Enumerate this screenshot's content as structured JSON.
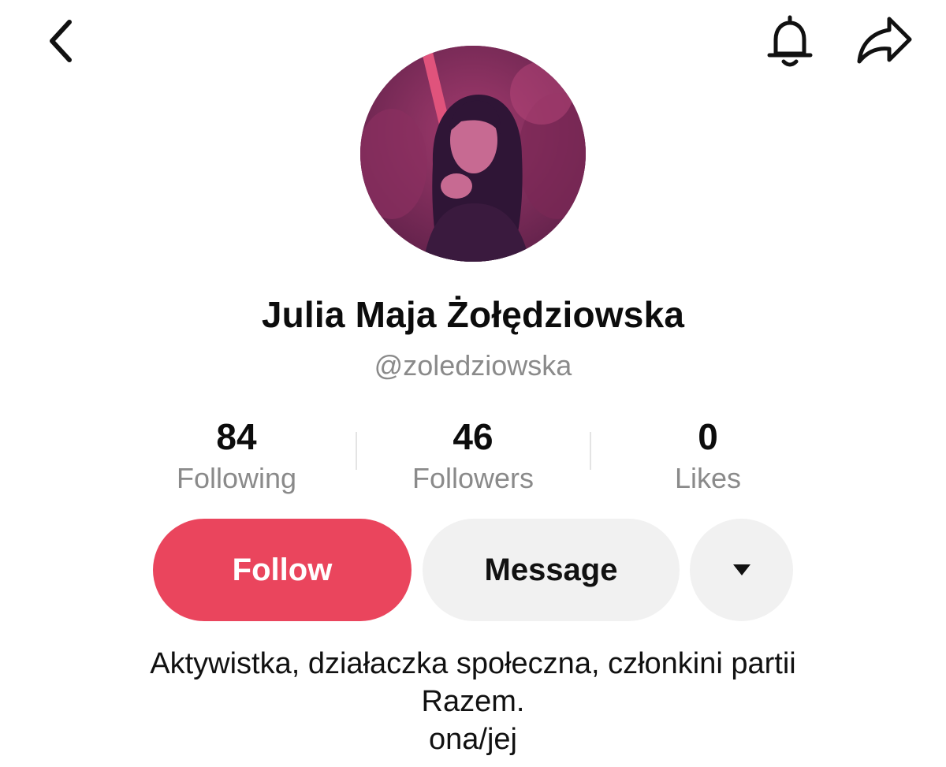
{
  "topbar": {
    "back_icon": "chevron-left-icon",
    "notify_icon": "bell-icon",
    "share_icon": "share-arrow-icon"
  },
  "profile": {
    "avatar_icon": "profile-photo",
    "display_name": "Julia Maja Żołędziowska",
    "handle": "@zoledziowska"
  },
  "stats": [
    {
      "value": "84",
      "label": "Following"
    },
    {
      "value": "46",
      "label": "Followers"
    },
    {
      "value": "0",
      "label": "Likes"
    }
  ],
  "actions": {
    "follow_label": "Follow",
    "message_label": "Message",
    "more_icon": "caret-down-icon",
    "follow_color": "#ea455d"
  },
  "bio": {
    "line1": "Aktywistka, działaczka społeczna, członkini partii",
    "line2": "Razem.",
    "line3": "ona/jej"
  }
}
